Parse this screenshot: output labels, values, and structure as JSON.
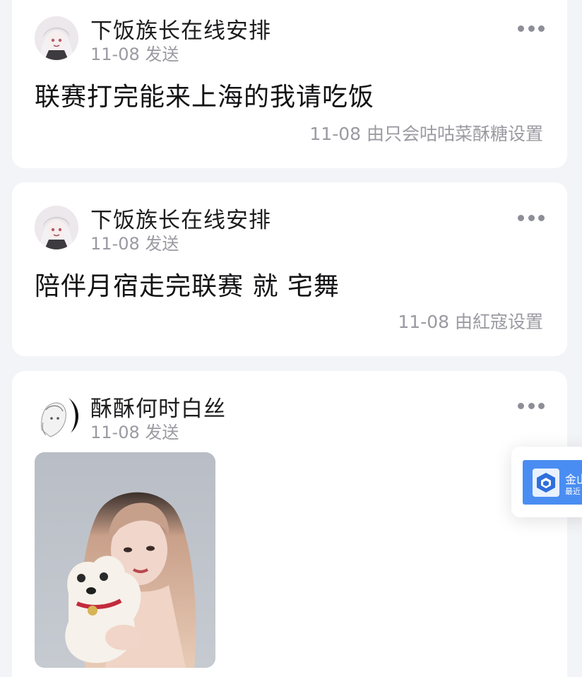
{
  "posts": [
    {
      "author": "下饭族长在线安排",
      "sent": "11-08 发送",
      "content": "联赛打完能来上海的我请吃饭",
      "setby": "11-08 由只会咕咕菜酥糖设置"
    },
    {
      "author": "下饭族长在线安排",
      "sent": "11-08 发送",
      "content": "陪伴月宿走完联赛 就 宅舞",
      "setby": "11-08 由紅寇设置"
    },
    {
      "author": "酥酥何时白丝",
      "sent": "11-08 发送"
    }
  ],
  "popup": {
    "app_name": "金山",
    "sub": "最近"
  },
  "icons": {
    "more": "more-horizontal-icon",
    "app": "kingsoft-docs-logo-icon"
  },
  "colors": {
    "background": "#f3f4f8",
    "card": "#ffffff",
    "meta_text": "#9a9aa2",
    "popup_accent": "#4a8df2"
  }
}
